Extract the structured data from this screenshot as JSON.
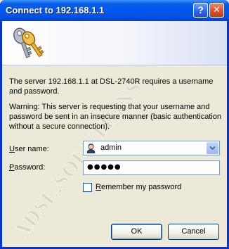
{
  "window": {
    "title": "Connect to 192.168.1.1",
    "help_glyph": "?",
    "close_glyph": "✕"
  },
  "banner": {
    "icon": "keys-icon"
  },
  "watermark": "ADSL.SOLUTIONS",
  "message": {
    "server": "The server 192.168.1.1 at DSL-2740R requires a username and password.",
    "warning": "Warning: This server is requesting that your username and password be sent in an insecure manner (basic authentication without a secure connection)."
  },
  "form": {
    "username_label_accel": "U",
    "username_label_rest": "ser name:",
    "username_value": "admin",
    "password_label_accel": "P",
    "password_label_rest": "assword:",
    "password_mask": "●●●●●",
    "remember_label_accel": "R",
    "remember_label_rest": "emember my password",
    "remember_checked": false
  },
  "buttons": {
    "ok": "OK",
    "cancel": "Cancel"
  },
  "colors": {
    "titlebar": "#0058ee",
    "client_bg": "#ece9d8",
    "field_border": "#7f9db9"
  }
}
